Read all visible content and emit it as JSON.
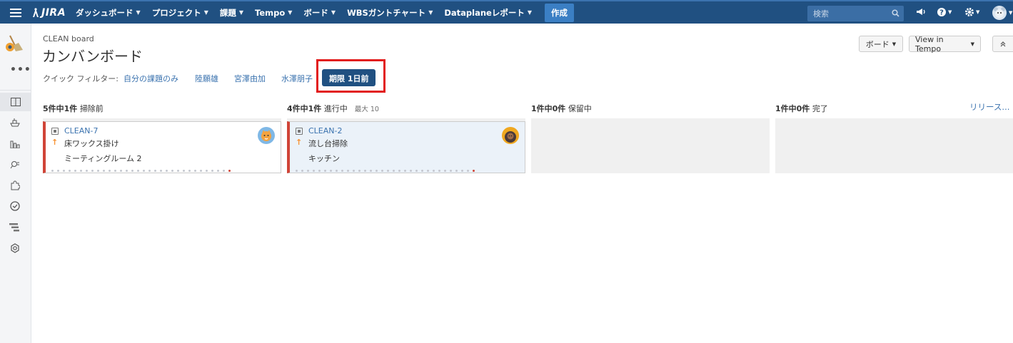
{
  "nav": {
    "logo": "JIRA",
    "items": [
      {
        "label": "ダッシュボード"
      },
      {
        "label": "プロジェクト"
      },
      {
        "label": "課題"
      },
      {
        "label": "Tempo"
      },
      {
        "label": "ボード"
      },
      {
        "label": "WBSガントチャート"
      },
      {
        "label": "Dataplaneレポート"
      }
    ],
    "create_label": "作成",
    "search_placeholder": "検索"
  },
  "header": {
    "project_name": "CLEAN board",
    "board_title": "カンバンボード",
    "board_button": "ボード",
    "tempo_button": "View in Tempo"
  },
  "quick_filters": {
    "label": "クイック フィルター:",
    "items": [
      "自分の課題のみ",
      "陸願雄",
      "宮澤由加",
      "水澤朋子"
    ],
    "active": "期限 1日前"
  },
  "columns": [
    {
      "count": "5件中1件",
      "name": "掃除前",
      "max": ""
    },
    {
      "count": "4件中1件",
      "name": "進行中",
      "max": "最大 10"
    },
    {
      "count": "1件中0件",
      "name": "保留中",
      "max": ""
    },
    {
      "count": "1件中0件",
      "name": "完了",
      "max": ""
    }
  ],
  "release_link": "リリース...",
  "cards": [
    {
      "key": "CLEAN-7",
      "summary": "床ワックス掛け",
      "field": "ミーティングルーム 2",
      "priority": "↑"
    },
    {
      "key": "CLEAN-2",
      "summary": "流し台掃除",
      "field": "キッチン",
      "priority": "↑"
    }
  ],
  "colors": {
    "nav_bg": "#205081",
    "link": "#3b73af",
    "active_filter": "#205081",
    "card_flag": "#d04437",
    "highlight_box": "#e21c1c"
  }
}
